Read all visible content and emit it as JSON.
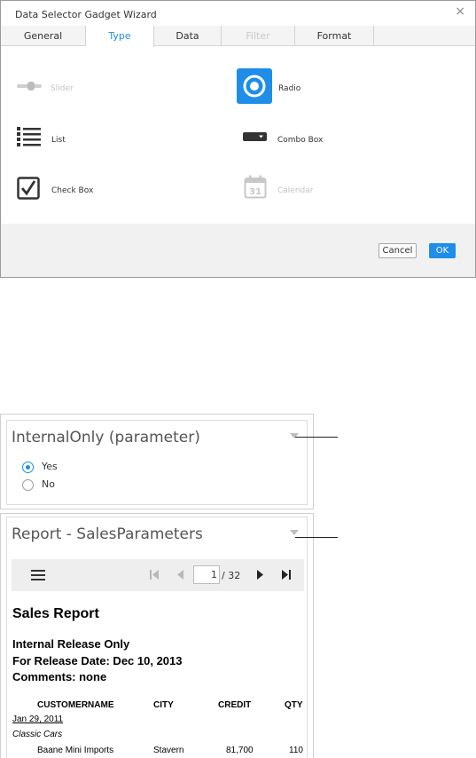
{
  "dialog": {
    "title": "Data Selector Gadget Wizard",
    "close_glyph": "×",
    "tabs": [
      {
        "label": "General",
        "state": "normal"
      },
      {
        "label": "Type",
        "state": "active"
      },
      {
        "label": "Data",
        "state": "normal"
      },
      {
        "label": "Filter",
        "state": "disabled"
      },
      {
        "label": "Format",
        "state": "normal"
      }
    ],
    "options": [
      {
        "label": "Slider",
        "icon": "slider-icon",
        "state": "disabled"
      },
      {
        "label": "Radio",
        "icon": "radio-icon",
        "state": "selected"
      },
      {
        "label": "List",
        "icon": "list-icon",
        "state": "normal"
      },
      {
        "label": "Combo Box",
        "icon": "combo-box-icon",
        "state": "normal"
      },
      {
        "label": "Check Box",
        "icon": "check-box-icon",
        "state": "normal"
      },
      {
        "label": "Calendar",
        "icon": "calendar-icon",
        "state": "disabled",
        "icon_text": "31"
      }
    ],
    "cancel_label": "Cancel",
    "ok_label": "OK",
    "accent_color": "#1e8ee8"
  },
  "panel_parameter": {
    "title": "InternalOnly (parameter)",
    "options": [
      {
        "label": "Yes",
        "checked": true
      },
      {
        "label": "No",
        "checked": false
      }
    ]
  },
  "panel_report": {
    "title": "Report - SalesParameters",
    "toolbar": {
      "current_page": "1",
      "total_pages": "/ 32"
    },
    "report": {
      "title": "Sales Report",
      "lines": [
        "Internal Release Only",
        "For Release Date: Dec 10, 2013",
        "Comments: none"
      ],
      "columns": [
        "CUSTOMERNAME",
        "CITY",
        "CREDIT",
        "QTY"
      ],
      "group_date": "Jan 29, 2011",
      "group_category": "Classic Cars",
      "row": {
        "customer": "Baane Mini Imports",
        "city": "Stavern",
        "credit": "81,700",
        "qty": "110"
      }
    }
  }
}
